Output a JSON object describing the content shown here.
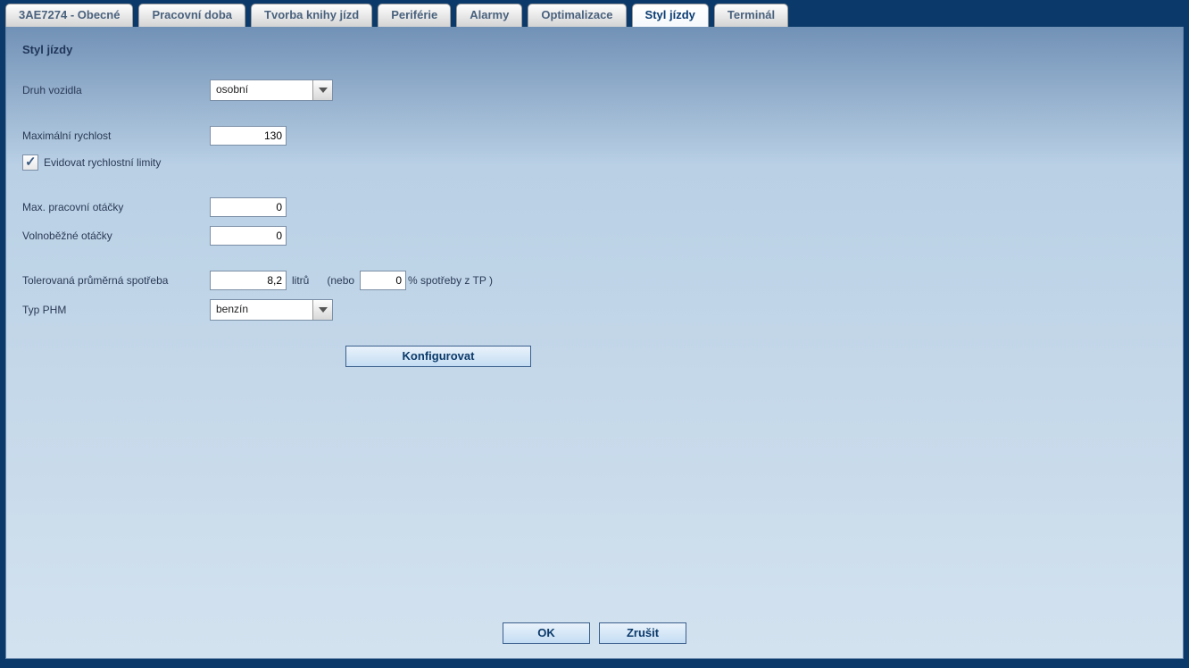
{
  "tabs": [
    "3AE7274 - Obecné",
    "Pracovní doba",
    "Tvorba knihy jízd",
    "Periférie",
    "Alarmy",
    "Optimalizace",
    "Styl jízdy",
    "Terminál"
  ],
  "active_tab_index": 6,
  "section_title": "Styl jízdy",
  "labels": {
    "vehicle_type": "Druh vozidla",
    "max_speed": "Maximální rychlost",
    "record_speed_limits": "Evidovat rychlostní limity",
    "max_work_rpm": "Max. pracovní otáčky",
    "idle_rpm": "Volnoběžné otáčky",
    "tolerated_avg_cons": "Tolerovaná průměrná spotřeba",
    "liters": "litrů",
    "or_open": "(nebo",
    "percent_close": "% spotřeby z TP )",
    "fuel_type": "Typ PHM"
  },
  "values": {
    "vehicle_type": "osobní",
    "max_speed": "130",
    "record_speed_limits": true,
    "max_work_rpm": "0",
    "idle_rpm": "0",
    "tolerated_avg_cons": "8,2",
    "cons_percent": "0",
    "fuel_type": "benzín"
  },
  "buttons": {
    "configure": "Konfigurovat",
    "ok": "OK",
    "cancel": "Zrušit"
  }
}
